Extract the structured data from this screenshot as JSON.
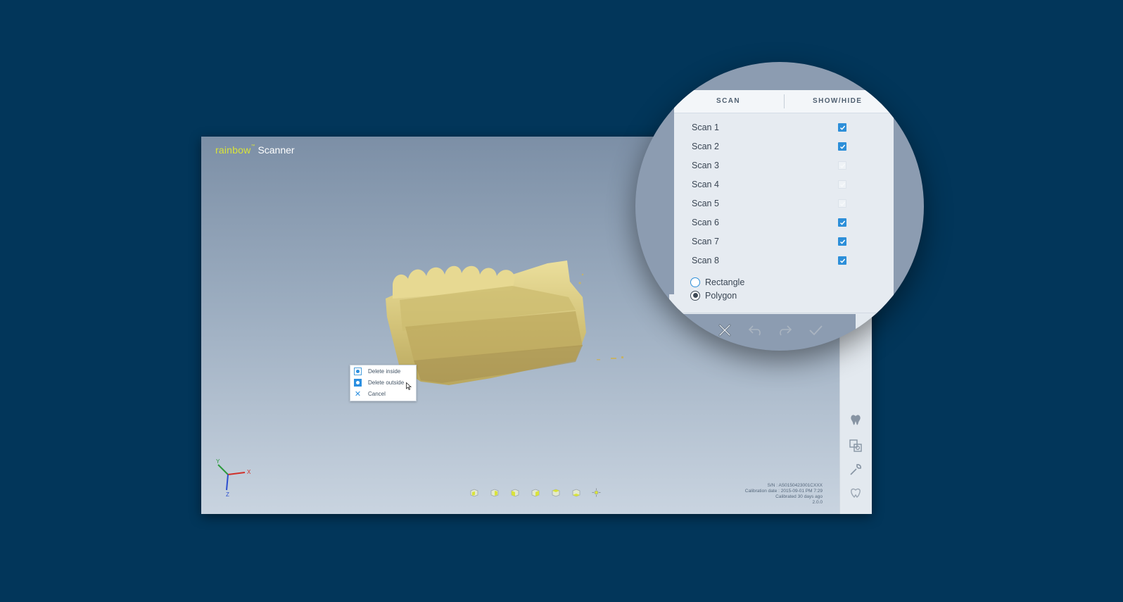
{
  "app": {
    "brand": "rainbow",
    "brand_mark": "™",
    "product": "Scanner"
  },
  "context_menu": {
    "items": [
      {
        "label": "Delete inside",
        "icon": "radio-dot-icon"
      },
      {
        "label": "Delete outside",
        "icon": "radio-filled-icon"
      },
      {
        "label": "Cancel",
        "icon": "close-icon"
      }
    ]
  },
  "axis": {
    "x": "X",
    "y": "Y",
    "z": "Z"
  },
  "view_buttons": [
    "cube-front-icon",
    "cube-back-icon",
    "cube-left-icon",
    "cube-right-icon",
    "cube-top-icon",
    "cube-bottom-icon",
    "fit-view-icon"
  ],
  "side_tools": [
    "tooth-icon",
    "layers-icon",
    "wrench-icon",
    "tooth-settings-icon"
  ],
  "status": {
    "serial": "S/N : AS0150423001CXXX",
    "calibration_date": "Calibration date : 2015-09-01 PM 7:29",
    "calibrated_ago": "Calibrated 30 days ago",
    "version": "2.0.0"
  },
  "scan_panel": {
    "col_scan": "SCAN",
    "col_show_hide": "SHOW/HIDE",
    "scans": [
      {
        "label": "Scan 1",
        "visible": true
      },
      {
        "label": "Scan 2",
        "visible": true
      },
      {
        "label": "Scan 3",
        "visible": false
      },
      {
        "label": "Scan 4",
        "visible": false
      },
      {
        "label": "Scan 5",
        "visible": false
      },
      {
        "label": "Scan 6",
        "visible": true
      },
      {
        "label": "Scan 7",
        "visible": true
      },
      {
        "label": "Scan 8",
        "visible": true
      }
    ],
    "selection_modes": [
      {
        "label": "Rectangle",
        "selected": false
      },
      {
        "label": "Polygon",
        "selected": true
      }
    ],
    "tools": [
      "close-icon",
      "undo-icon",
      "redo-icon",
      "check-icon"
    ]
  },
  "colors": {
    "background": "#02365a",
    "accent": "#2d8fd9",
    "brand": "#d9e33a",
    "model": "#d8c777"
  }
}
